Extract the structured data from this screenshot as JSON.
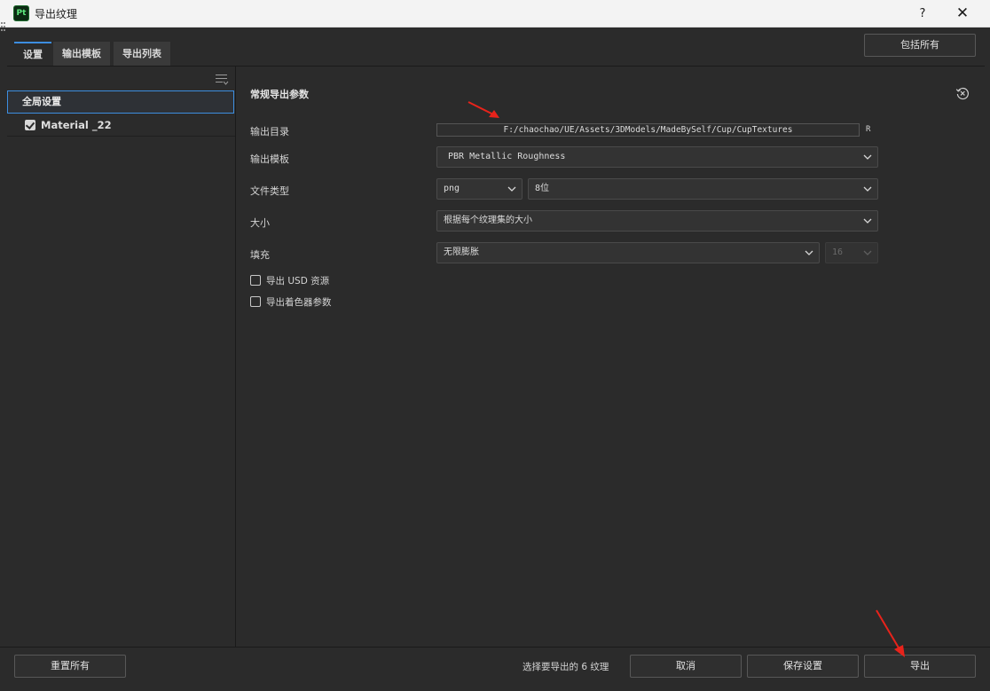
{
  "window": {
    "title": "导出纹理",
    "app_icon_text": "Pt",
    "help_label": "?",
    "close_label": "✕"
  },
  "tabs": [
    {
      "label": "设置",
      "active": true
    },
    {
      "label": "输出模板",
      "active": false
    },
    {
      "label": "导出列表",
      "active": false
    }
  ],
  "header": {
    "include_all_label": "包括所有"
  },
  "sidebar": {
    "global_settings_label": "全局设置",
    "materials": [
      {
        "label": "Material _22",
        "checked": true
      }
    ]
  },
  "settings": {
    "section_title": "常规导出参数",
    "output_dir_label": "输出目录",
    "output_dir_value": "F:/chaochao/UE/Assets/3DModels/MadeBySelf/Cup/CupTextures",
    "output_dir_suffix": "R",
    "template_label": "输出模板",
    "template_value": "PBR Metallic Roughness",
    "file_type_label": "文件类型",
    "file_type_value": "png",
    "bit_depth_value": "8位",
    "size_label": "大小",
    "size_value": "根据每个纹理集的大小",
    "padding_label": "填充",
    "padding_value": "无限膨胀",
    "padding_amount_value": "16",
    "export_usd_label": "导出 USD 资源",
    "export_usd_checked": false,
    "export_shader_label": "导出着色器参数",
    "export_shader_checked": false
  },
  "footer": {
    "reset_all_label": "重置所有",
    "status_text": "选择要导出的 6 纹理",
    "cancel_label": "取消",
    "save_settings_label": "保存设置",
    "export_label": "导出"
  },
  "colors": {
    "accent": "#3d8ee0",
    "annotation": "#e8231b",
    "panel_bg": "#2b2b2b",
    "titlebar_bg": "#f3f3f3"
  }
}
